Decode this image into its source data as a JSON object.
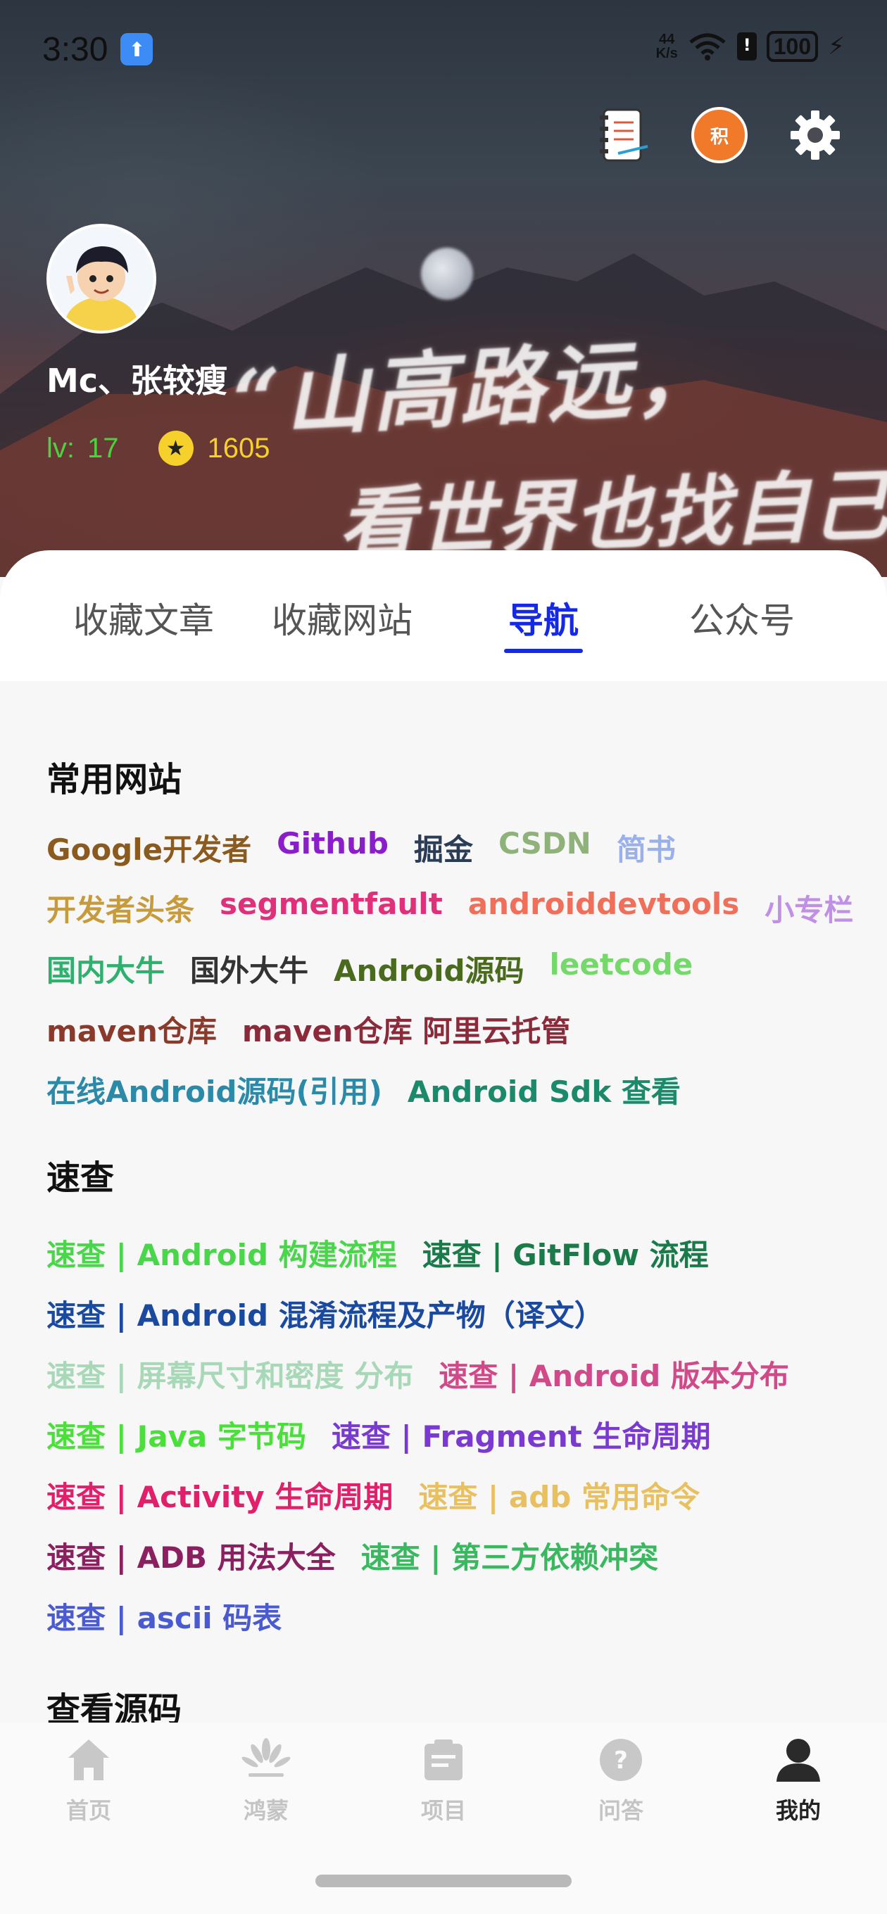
{
  "status_bar": {
    "time": "3:30",
    "net_speed_value": "44",
    "net_speed_unit": "K/s",
    "battery": "100"
  },
  "header": {
    "icons": [
      "notebook-icon",
      "points-icon",
      "settings-icon"
    ],
    "points_badge": "积",
    "background_text_line1": "“山高路远，",
    "background_text_line2": "看世界也找自己。"
  },
  "profile": {
    "username": "Mc、张较瘦",
    "level_label": "lv:",
    "level": "17",
    "coins": "1605"
  },
  "tabs": [
    {
      "label": "收藏文章",
      "active": false
    },
    {
      "label": "收藏网站",
      "active": false
    },
    {
      "label": "导航",
      "active": true
    },
    {
      "label": "公众号",
      "active": false
    }
  ],
  "sections": {
    "common_sites": {
      "title": "常用网站",
      "rows": [
        [
          {
            "label": "Google开发者",
            "color": "#8b5a1e"
          },
          {
            "label": "Github",
            "color": "#8a1fc9"
          },
          {
            "label": "掘金",
            "color": "#2b3c55"
          },
          {
            "label": "CSDN",
            "color": "#8fb27a"
          },
          {
            "label": "简书",
            "color": "#9ab0ea"
          }
        ],
        [
          {
            "label": "开发者头条",
            "color": "#c79a3b"
          },
          {
            "label": "segmentfault",
            "color": "#e0307a"
          },
          {
            "label": "androiddevtools",
            "color": "#ef6f5a"
          },
          {
            "label": "小专栏",
            "color": "#c090e6"
          }
        ],
        [
          {
            "label": "国内大牛",
            "color": "#2fb06e"
          },
          {
            "label": "国外大牛",
            "color": "#333333"
          },
          {
            "label": "Android源码",
            "color": "#4a6a1e"
          },
          {
            "label": "leetcode",
            "color": "#74d86a"
          }
        ],
        [
          {
            "label": "maven仓库",
            "color": "#8a3a2a"
          },
          {
            "label": "maven仓库 阿里云托管",
            "color": "#8a2a3a"
          }
        ],
        [
          {
            "label": "在线Android源码(引用)",
            "color": "#2a8aa8"
          },
          {
            "label": "Android Sdk 查看",
            "color": "#1a8a6a"
          }
        ]
      ]
    },
    "quick": {
      "title": "速查",
      "rows": [
        [
          {
            "label": "速查 | Android 构建流程",
            "color": "#4ad64a"
          },
          {
            "label": "速查 | GitFlow 流程",
            "color": "#1a7a4a"
          }
        ],
        [
          {
            "label": "速查 | Android 混淆流程及产物（译文）",
            "color": "#1a4aa0"
          }
        ],
        [
          {
            "label": "速查 | 屏幕尺寸和密度 分布",
            "color": "#a8d8b8"
          },
          {
            "label": "速查 | Android 版本分布",
            "color": "#d04a8a"
          }
        ],
        [
          {
            "label": "速查 | Java 字节码",
            "color": "#4ae03a"
          },
          {
            "label": "速查 | Fragment 生命周期",
            "color": "#7a3ad0"
          }
        ],
        [
          {
            "label": "速查 | Activity 生命周期",
            "color": "#e0206a"
          },
          {
            "label": "速查 | adb 常用命令",
            "color": "#e8c060"
          }
        ],
        [
          {
            "label": "速查 | ADB 用法大全",
            "color": "#8a2060"
          },
          {
            "label": "速查 | 第三方依赖冲突",
            "color": "#3ab860"
          }
        ],
        [
          {
            "label": "速查 | ascii 码表",
            "color": "#4a5ad0"
          }
        ]
      ]
    },
    "source": {
      "title": "查看源码"
    }
  },
  "bottom_nav": [
    {
      "label": "首页",
      "icon": "home-icon",
      "active": false
    },
    {
      "label": "鸿蒙",
      "icon": "harmony-icon",
      "active": false
    },
    {
      "label": "项目",
      "icon": "project-icon",
      "active": false
    },
    {
      "label": "问答",
      "icon": "question-icon",
      "active": false
    },
    {
      "label": "我的",
      "icon": "profile-icon",
      "active": true
    }
  ]
}
